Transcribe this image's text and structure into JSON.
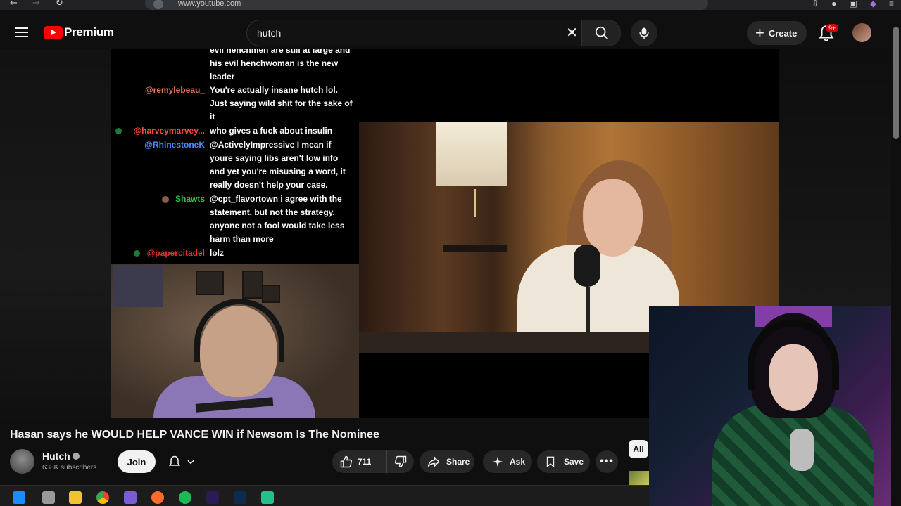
{
  "browser": {
    "url": "www.youtube.com"
  },
  "header": {
    "logo_text": "Premium",
    "search_query": "hutch",
    "create_label": "Create",
    "notification_count": "9+"
  },
  "chat": [
    {
      "user": "",
      "user_color": "#ffffff",
      "msg": "evil henchmen are still at large and his evil henchwoman is the new leader"
    },
    {
      "user": "@remylebeau_",
      "user_color": "#e0795a",
      "msg": "You're actually insane hutch lol. Just saying wild shit for the sake of it"
    },
    {
      "user": "@harveymarvey...",
      "user_color": "#ff4a3d",
      "msg": "who gives a fuck about insulin"
    },
    {
      "user": "@RhinestoneK",
      "user_color": "#4f8cff",
      "msg": "@ActivelyImpressive I mean if youre saying libs aren't low info and yet you're misusing a word, it really doesn't help your case."
    },
    {
      "user": "Shawts",
      "user_color": "#2fbf4a",
      "msg": "@cpt_flavortown i agree with the statement, but not the strategy. anyone not a fool would take less harm than more"
    },
    {
      "user": "@papercitadel",
      "user_color": "#e5322d",
      "msg": "lolz"
    }
  ],
  "video": {
    "title": "Hasan says he WOULD HELP VANCE WIN if Newsom Is The Nominee",
    "channel": "Hutch",
    "subscribers": "638K subscribers",
    "join_label": "Join",
    "likes": "711",
    "share_label": "Share",
    "ask_label": "Ask",
    "save_label": "Save"
  },
  "chips": {
    "all_label": "All"
  },
  "colors": {
    "brand": "#ff0000",
    "background": "#0f0f0f",
    "pill": "#272727"
  }
}
